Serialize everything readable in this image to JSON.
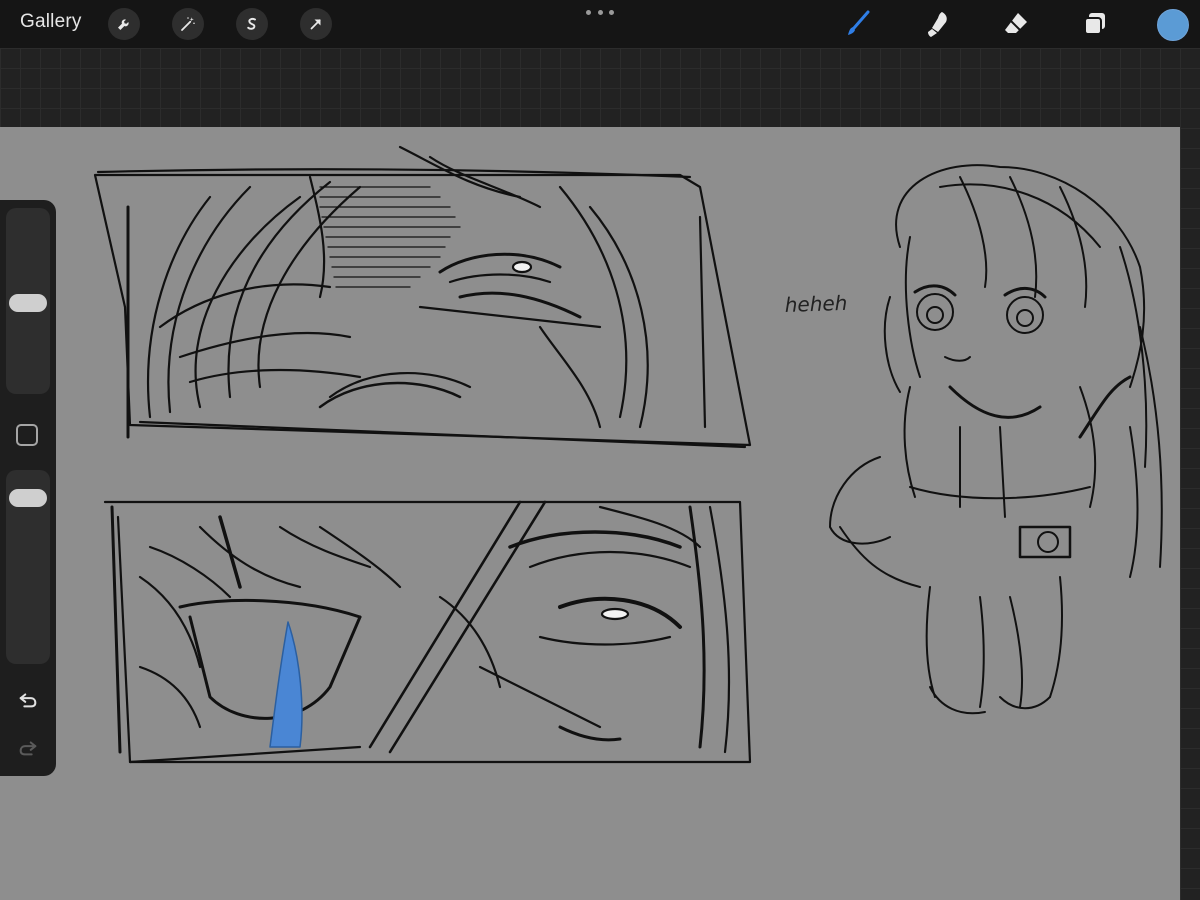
{
  "topbar": {
    "gallery_label": "Gallery",
    "left_tools": [
      {
        "name": "adjustments",
        "icon": "wrench-icon"
      },
      {
        "name": "adjust",
        "icon": "magic-wand-icon"
      },
      {
        "name": "selection",
        "icon": "selection-s-icon"
      },
      {
        "name": "transform",
        "icon": "transform-arrow-icon"
      }
    ],
    "right_tools": [
      {
        "name": "brush",
        "icon": "brush-icon",
        "active": true
      },
      {
        "name": "smudge",
        "icon": "smudge-icon",
        "active": false
      },
      {
        "name": "eraser",
        "icon": "eraser-icon",
        "active": false
      },
      {
        "name": "layers",
        "icon": "layers-icon",
        "active": false
      }
    ],
    "current_color": "#5b9bd5"
  },
  "sidebar": {
    "brush_size": 0.49,
    "opacity": 0.92
  },
  "canvas": {
    "annotation_text": "heheh",
    "accent_blue": "#4a86d4"
  },
  "colors": {
    "active_tool": "#2f7ee6",
    "canvas_bg": "#8e8e8e"
  }
}
